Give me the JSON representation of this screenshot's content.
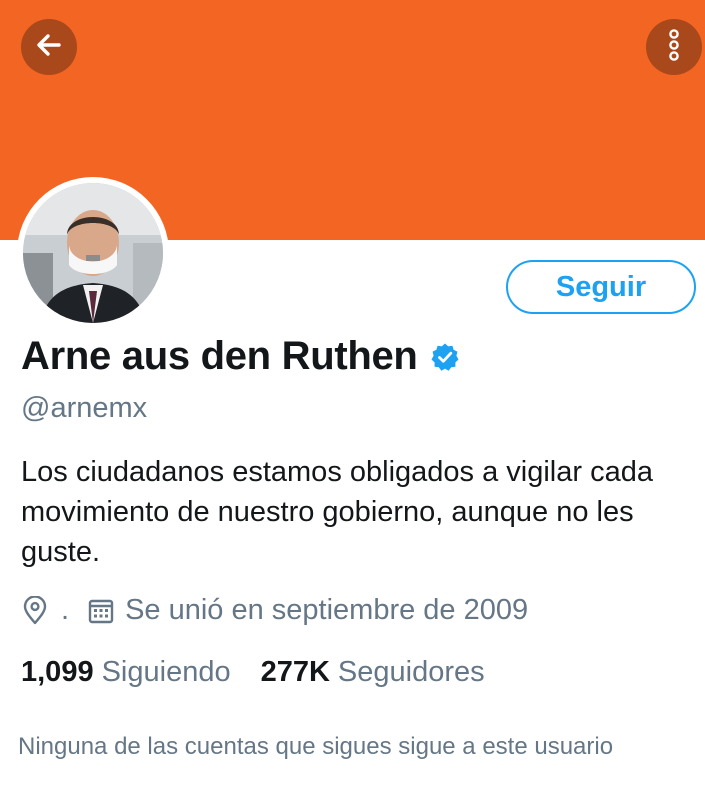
{
  "header": {
    "banner_color": "#F26522",
    "back_icon": "arrow-left-icon",
    "more_icon": "more-vertical-icon"
  },
  "profile": {
    "name": "Arne aus den Ruthen",
    "verified_icon": "verified-badge-icon",
    "handle": "@arnemx",
    "bio": "Los ciudadanos estamos obligados a vigilar cada movimiento de nuestro gobierno, aunque no les guste.",
    "location": ".",
    "location_icon": "location-pin-icon",
    "joined": "Se unió en septiembre de 2009",
    "joined_icon": "calendar-icon",
    "follow_label": "Seguir"
  },
  "stats": {
    "following_count": "1,099",
    "following_label": "Siguiendo",
    "followers_count": "277K",
    "followers_label": "Seguidores"
  },
  "note": "Ninguna de las cuentas que sigues sigue a este usuario",
  "colors": {
    "accent": "#1DA1F2",
    "secondary_text": "#657786",
    "primary_text": "#14171A"
  }
}
